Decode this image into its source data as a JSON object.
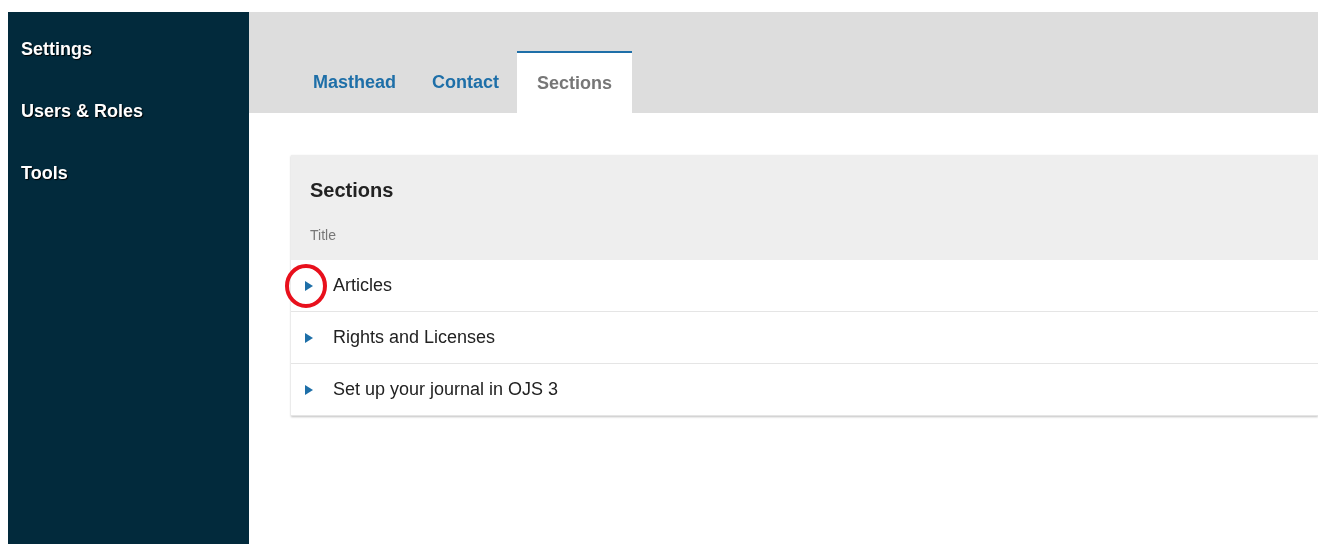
{
  "sidebar": {
    "items": [
      {
        "label": "Settings"
      },
      {
        "label": "Users & Roles"
      },
      {
        "label": "Tools"
      }
    ]
  },
  "tabs": [
    {
      "label": "Masthead",
      "selected": false
    },
    {
      "label": "Contact",
      "selected": false
    },
    {
      "label": "Sections",
      "selected": true
    }
  ],
  "panel": {
    "title": "Sections",
    "column": "Title",
    "rows": [
      {
        "title": "Articles",
        "circled": true
      },
      {
        "title": "Rights and Licenses",
        "circled": false
      },
      {
        "title": "Set up your journal in OJS 3",
        "circled": false
      }
    ]
  }
}
